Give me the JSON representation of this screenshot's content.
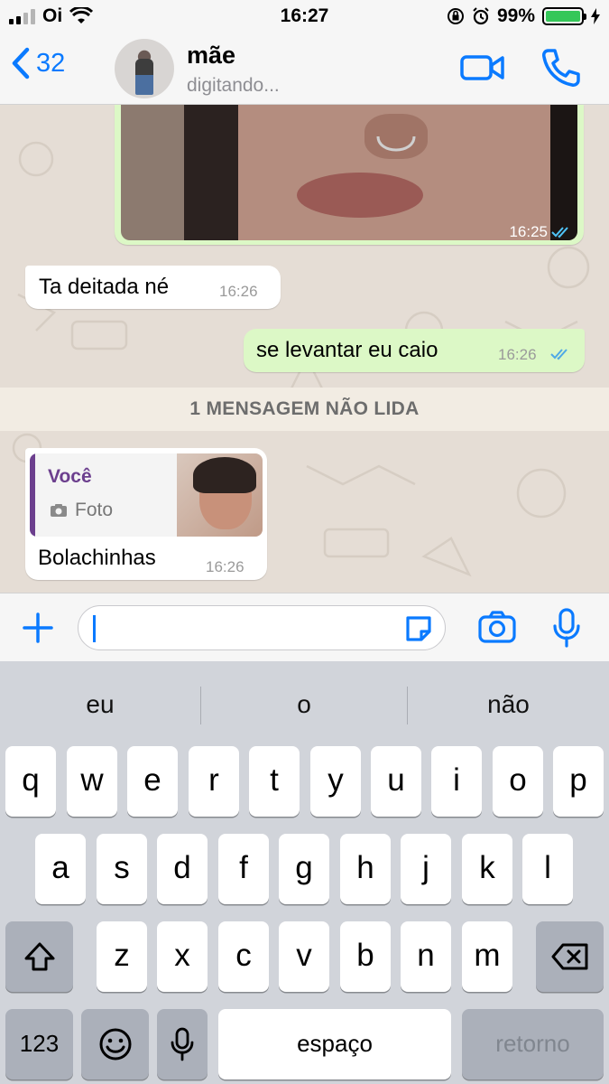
{
  "status_bar": {
    "carrier": "Oi",
    "time": "16:27",
    "battery": "99%",
    "signal_bars_filled": 2,
    "battery_level": 0.99
  },
  "header": {
    "back_count": "32",
    "contact_name": "mãe",
    "contact_status": "digitando...",
    "accent_color": "#0a7aff"
  },
  "messages": [
    {
      "type": "image",
      "direction": "out",
      "time": "16:25",
      "read": true
    },
    {
      "type": "text",
      "direction": "in",
      "text": "Ta deitada né",
      "time": "16:26"
    },
    {
      "type": "text",
      "direction": "out",
      "text": "se levantar eu caio",
      "time": "16:26",
      "read": true
    },
    {
      "type": "reply",
      "direction": "in",
      "quote_author": "Você",
      "quote_type": "Foto",
      "text": "Bolachinhas",
      "time": "16:26"
    }
  ],
  "unread_banner": "1 MENSAGEM NÃO LIDA",
  "input": {
    "value": "",
    "placeholder": ""
  },
  "keyboard": {
    "suggestions": [
      "eu",
      "o",
      "não"
    ],
    "row1": [
      "q",
      "w",
      "e",
      "r",
      "t",
      "y",
      "u",
      "i",
      "o",
      "p"
    ],
    "row2": [
      "a",
      "s",
      "d",
      "f",
      "g",
      "h",
      "j",
      "k",
      "l"
    ],
    "row3": [
      "z",
      "x",
      "c",
      "v",
      "b",
      "n",
      "m"
    ],
    "numbers_label": "123",
    "space_label": "espaço",
    "return_label": "retorno"
  },
  "icons": [
    "back-chevron-icon",
    "video-call-icon",
    "phone-icon",
    "plus-icon",
    "sticker-icon",
    "camera-icon",
    "microphone-icon",
    "shift-icon",
    "backspace-icon",
    "emoji-icon",
    "dictation-icon",
    "double-check-icon"
  ]
}
